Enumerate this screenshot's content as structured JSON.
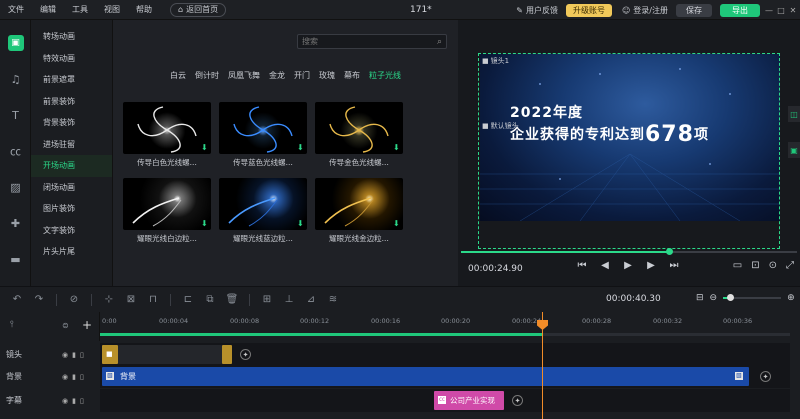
{
  "menubar": {
    "items": [
      "文件",
      "编辑",
      "工具",
      "视图",
      "帮助"
    ],
    "home_label": "返回首页",
    "title": "171*",
    "feedback": "用户反馈",
    "upgrade": "升级账号",
    "login": "登录/注册",
    "save": "保存",
    "export": "导出",
    "window_controls": [
      "—",
      "□",
      "✕"
    ]
  },
  "leftbar": {
    "icons": [
      "film-icon",
      "music-icon",
      "text-icon",
      "caption-icon",
      "filter-icon",
      "puzzle-icon",
      "folder-icon"
    ]
  },
  "categories": {
    "items": [
      "转场动画",
      "特效动画",
      "前景遮罩",
      "前景装饰",
      "背景装饰",
      "进场驻留",
      "开场动画",
      "闭场动画",
      "图片装饰",
      "文字装饰",
      "片头片尾"
    ],
    "active_index": 6
  },
  "library": {
    "search_placeholder": "搜索",
    "tabs": [
      "白云",
      "倒计时",
      "凤凰飞舞",
      "金龙",
      "开门",
      "玫瑰",
      "幕布",
      "粒子光线"
    ],
    "active_tab": 7,
    "tiles": [
      {
        "label": "传导白色光线螺...",
        "tone": "#e8e8e8"
      },
      {
        "label": "传导蓝色光线螺...",
        "tone": "#3a8cff"
      },
      {
        "label": "传导金色光线螺...",
        "tone": "#e6b84a"
      },
      {
        "label": "耀眼光线白边粒...",
        "tone": "#f2f2f2"
      },
      {
        "label": "耀眼光线蓝边粒...",
        "tone": "#4a9aff"
      },
      {
        "label": "耀眼光线金边粒...",
        "tone": "#f0c050"
      }
    ]
  },
  "preview": {
    "lens1": "镜头1",
    "lens_default": "默认镜头",
    "line1": "2022年度",
    "line2_prefix": "企业获得的专利达到",
    "line2_number": "678",
    "line2_suffix": "项",
    "time": "00:00:24.90",
    "progress": 0.62,
    "controls": [
      "⏮",
      "◀",
      "▶",
      "▶",
      "⏭"
    ],
    "right_controls": [
      "▭",
      "⊡",
      "⊙",
      "⤢"
    ]
  },
  "toolbar": {
    "icons": [
      "↶",
      "↷",
      "⊘",
      "⊹",
      "⊠",
      "⊓",
      "⊏",
      "⧉",
      "🗑",
      "⊞",
      "⊥",
      "⊿",
      "≋"
    ],
    "time": "00:00:40.30",
    "zoom_out": "⊖",
    "zoom_in": "⊕",
    "zoom_value": 0.1
  },
  "timeline": {
    "ticks": [
      "0:00",
      "00:00:04",
      "00:00:08",
      "00:00:12",
      "00:00:16",
      "00:00:20",
      "00:00:24",
      "00:00:28",
      "00:00:32",
      "00:00:36"
    ],
    "playhead": "00:00:24",
    "tracks": [
      {
        "name": "镜头"
      },
      {
        "name": "背景",
        "clip": "背景"
      },
      {
        "name": "字幕",
        "clip": "公司产业实现"
      }
    ]
  },
  "colors": {
    "accent": "#1fc77a",
    "upgrade": "#f1c95a",
    "background_clip": "#1a4aa8",
    "caption_clip": "#d04aa8",
    "playhead": "#f28c28"
  }
}
